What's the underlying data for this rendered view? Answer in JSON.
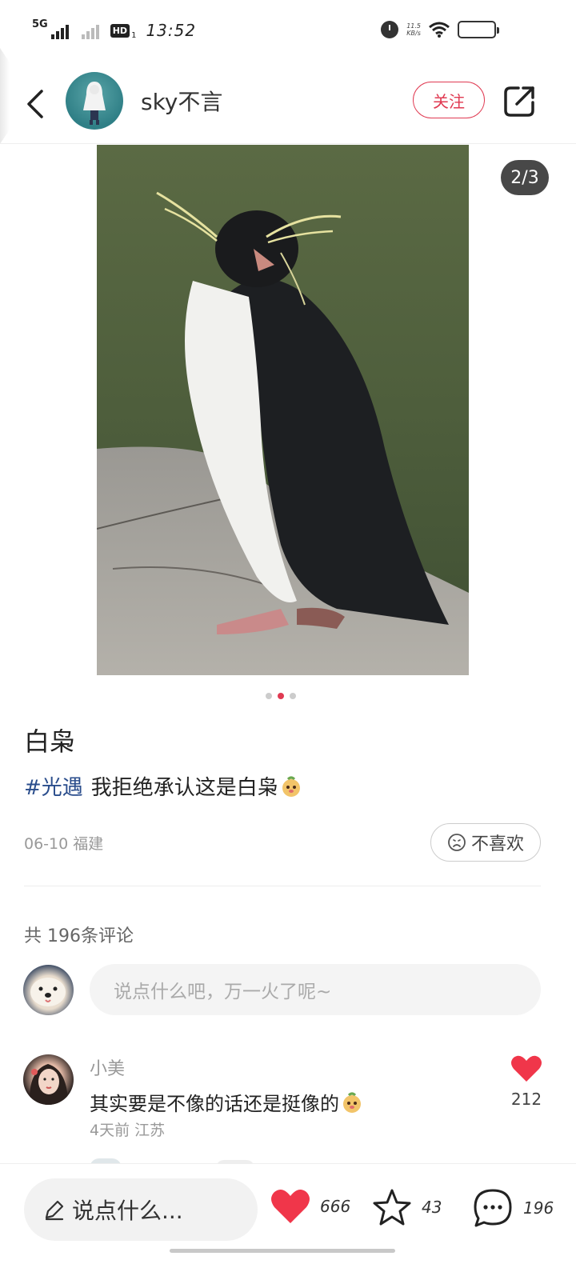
{
  "status_bar": {
    "network": "5G",
    "hd_label": "HD",
    "sim_index": "1",
    "time": "13:52",
    "speed_value": "11.5",
    "speed_unit": "KB/s",
    "icons": [
      "signal-icon",
      "signal-weak-icon",
      "hd-icon",
      "alarm-icon",
      "wifi-icon",
      "battery-icon"
    ]
  },
  "header": {
    "author_name": "sky不言",
    "follow_label": "关注",
    "icons": {
      "back": "back-arrow-icon",
      "share": "share-icon"
    }
  },
  "gallery": {
    "counter": "2/3",
    "current_index": 2,
    "total": 3
  },
  "post": {
    "title": "白枭",
    "hashtag": "#光遇",
    "text": "我拒绝承认这是白枭",
    "date_location": "06-10 福建",
    "dislike_label": "不喜欢"
  },
  "comments": {
    "count_label": "共 196条评论",
    "input_placeholder": "说点什么吧，万一火了呢~",
    "items": [
      {
        "user": "小美",
        "text": "其实要是不像的话还是挺像的",
        "meta": "4天前  江苏",
        "likes": "212"
      }
    ]
  },
  "bottom_bar": {
    "say_label": "说点什么...",
    "likes": "666",
    "favorites": "43",
    "comments": "196"
  },
  "colors": {
    "accent": "#e03a52",
    "hashtag": "#2a4d8c",
    "muted": "#999999"
  }
}
